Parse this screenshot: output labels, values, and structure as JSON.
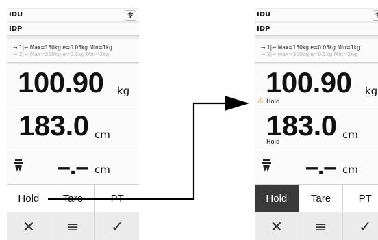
{
  "before": {
    "header": {
      "row1": "IDU",
      "row2": "IDP"
    },
    "scale_info": {
      "line1": "→|1|← Max=150kg e=0.05kg Min=1kg",
      "line2": "→|2|← Max=300kg e=0.1kg Min=2kg"
    },
    "weight": {
      "value": "100.90",
      "unit": "kg"
    },
    "height": {
      "value": "183.0",
      "unit": "cm"
    },
    "third": {
      "value": "–.–",
      "unit": "cm"
    },
    "softkeys": [
      "Hold",
      "Tare",
      "PT"
    ],
    "nav": {
      "cancel": "✕",
      "menu": "≡",
      "ok": "✓"
    }
  },
  "after": {
    "header": {
      "row1": "IDU",
      "row2": "IDP"
    },
    "scale_info": {
      "line1": "→|1|← Max=150kg e=0.05kg Min=1kg",
      "line2": "→|2|← Max=300kg e=0.1kg Min=2kg"
    },
    "weight": {
      "value": "100.90",
      "unit": "kg",
      "hold_label": "Hold",
      "warning": "⚠"
    },
    "height": {
      "value": "183.0",
      "unit": "cm",
      "hold_label": "Hold"
    },
    "third": {
      "value": "–.–",
      "unit": "cm"
    },
    "softkeys": [
      "Hold",
      "Tare",
      "PT"
    ],
    "active_softkey": "Hold",
    "nav": {
      "cancel": "✕",
      "menu": "≡",
      "ok": "✓"
    }
  },
  "icons": {
    "status": "wifi-icon",
    "person": "person-icon",
    "annotation": "flow-arrow"
  },
  "colors": {
    "active_softkey_bg": "#3a3a3a",
    "warning": "#e8a317",
    "panel_bg": "#fafafa"
  }
}
